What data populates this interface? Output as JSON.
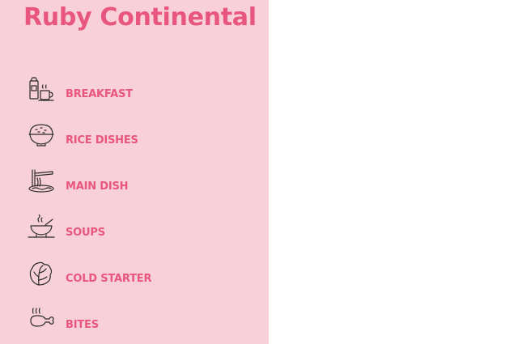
{
  "brand": {
    "title": "Ruby Continental"
  },
  "menu": {
    "items": [
      {
        "label": "BREAKFAST",
        "icon": "breakfast-icon"
      },
      {
        "label": "RICE DISHES",
        "icon": "rice-bowl-icon"
      },
      {
        "label": "MAIN DISH",
        "icon": "noodles-icon"
      },
      {
        "label": "SOUPS",
        "icon": "soup-bowl-icon"
      },
      {
        "label": "COLD STARTER",
        "icon": "lettuce-icon"
      },
      {
        "label": "BITES",
        "icon": "chicken-leg-icon"
      }
    ]
  },
  "colors": {
    "sidebar_background": "#f8d0da",
    "accent": "#e8557e",
    "icon_stroke": "#2b2b2b",
    "page_background": "#ffffff"
  }
}
